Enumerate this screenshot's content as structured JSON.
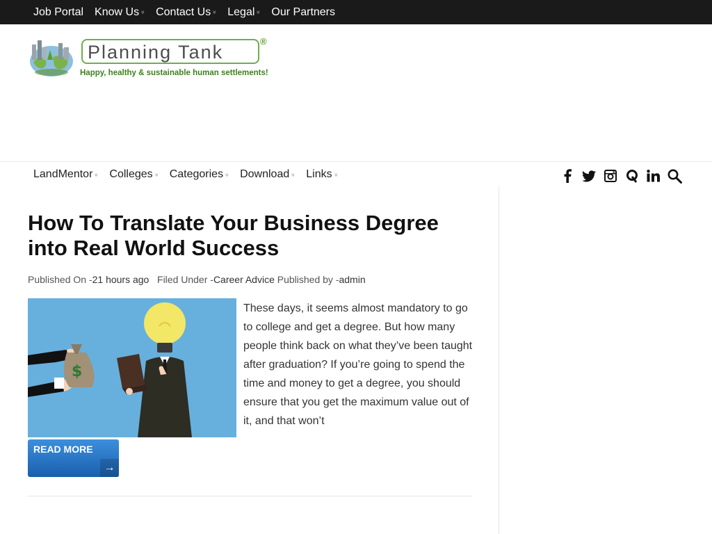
{
  "top_nav": {
    "items": [
      {
        "label": "Job Portal",
        "has_dropdown": false
      },
      {
        "label": "Know Us",
        "has_dropdown": true
      },
      {
        "label": "Contact Us",
        "has_dropdown": true
      },
      {
        "label": "Legal",
        "has_dropdown": true
      },
      {
        "label": "Our Partners",
        "has_dropdown": false
      }
    ],
    "dropdown_glyph": "»"
  },
  "logo": {
    "title": "Planning Tank",
    "registered_mark": "®",
    "tagline": "Happy, healthy & sustainable human settlements!"
  },
  "main_nav": {
    "items": [
      {
        "label": "LandMentor"
      },
      {
        "label": "Colleges"
      },
      {
        "label": "Categories"
      },
      {
        "label": "Download"
      },
      {
        "label": "Links"
      }
    ],
    "dropdown_glyph": "»"
  },
  "social": {
    "icons": [
      "facebook-icon",
      "twitter-icon",
      "instagram-icon",
      "quora-icon",
      "linkedin-icon",
      "search-icon"
    ]
  },
  "article": {
    "title": "How To Translate Your Business Degree into Real World Success",
    "meta": {
      "published_label": "Published On -",
      "published_value": "21 hours ago",
      "filed_label": "Filed Under -",
      "filed_value": "Career Advice",
      "author_label": "Published by -",
      "author_value": "admin"
    },
    "excerpt": "These days, it seems almost mandatory to go to college and get a degree. But how many people think back on what they’ve been taught after graduation? If you’re going to spend the time and money to get a degree, you should ensure that you get the maximum value out of it, and that won’t",
    "read_more_label": "READ MORE",
    "read_more_arrow": "→"
  },
  "colors": {
    "topbar_bg": "#1a1a1a",
    "accent_blue": "#2a74c4",
    "logo_green": "#5aa02c",
    "thumbnail_bg": "#67b0dd"
  }
}
